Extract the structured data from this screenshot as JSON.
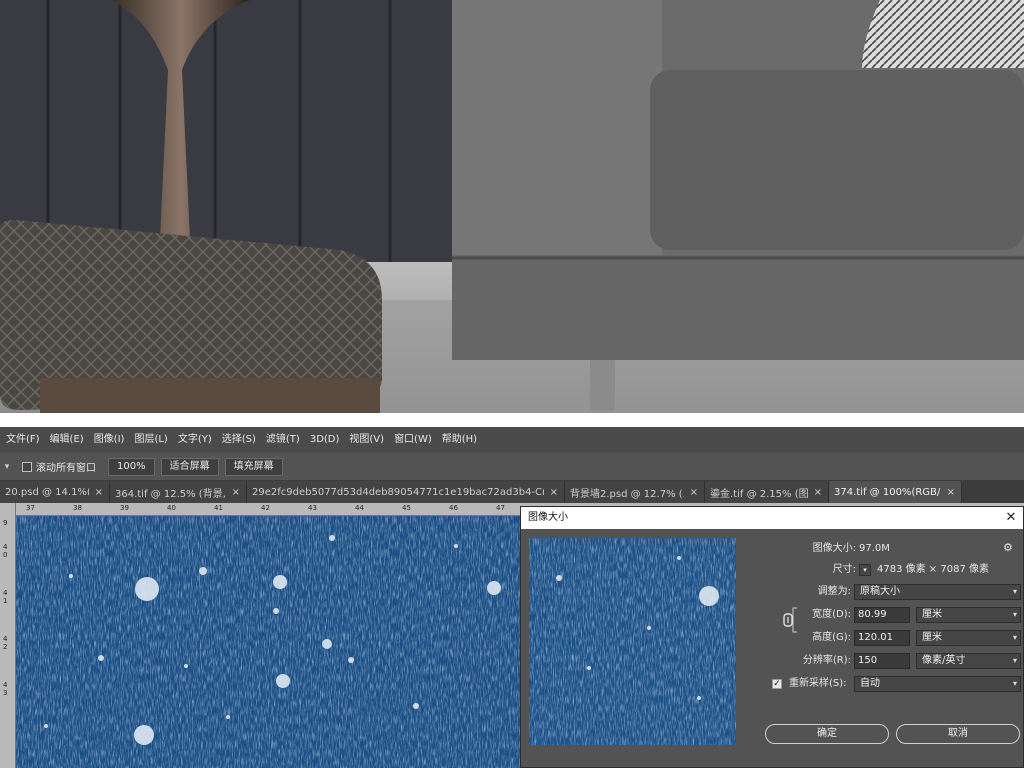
{
  "menu": [
    "文件(F)",
    "编辑(E)",
    "图像(I)",
    "图层(L)",
    "文字(Y)",
    "选择(S)",
    "滤镜(T)",
    "3D(D)",
    "视图(V)",
    "窗口(W)",
    "帮助(H)"
  ],
  "options": {
    "scroll_all_label": "滚动所有窗口",
    "zoom_btn": "100%",
    "fit_screen_btn": "适合屏幕",
    "fill_screen_btn": "填充屏幕"
  },
  "tabs": [
    {
      "label": "20.psd @ 14.1%(RG...",
      "active": false
    },
    {
      "label": "364.tif @ 12.5% (背景, R...",
      "active": false
    },
    {
      "label": "29e2fc9deb5077d53d4deb89054771c1e19bac72ad3b4-CrBj0S.png",
      "active": false
    },
    {
      "label": "背景墙2.psd @ 12.7% (...",
      "active": false
    },
    {
      "label": "鎏金.tif @ 2.15% (图层 1...",
      "active": false
    },
    {
      "label": "374.tif @ 100%(RGB/8#)",
      "active": true
    }
  ],
  "ruler": {
    "top": [
      "37",
      "38",
      "39",
      "40",
      "41",
      "42",
      "43",
      "44",
      "45",
      "46",
      "47"
    ],
    "left": [
      "9",
      "4 0",
      "4 1",
      "4 2",
      "4 3"
    ]
  },
  "dialog": {
    "title": "图像大小",
    "close_icon": "close-icon",
    "image_size_label": "图像大小:",
    "image_size_value": "97.0M",
    "dimensions_label": "尺寸:",
    "dimensions_value": "4783 像素 × 7087 像素",
    "fit_to_label": "调整为:",
    "fit_to_value": "原稿大小",
    "width_label": "宽度(D):",
    "width_value": "80.99",
    "width_unit": "厘米",
    "height_label": "高度(G):",
    "height_value": "120.01",
    "height_unit": "厘米",
    "resolution_label": "分辨率(R):",
    "resolution_value": "150",
    "resolution_unit": "像素/英寸",
    "resample_label": "重新采样(S):",
    "resample_value": "自动",
    "ok_label": "确定",
    "cancel_label": "取消"
  },
  "colors": {
    "canvas_blue": "#1b4f86",
    "panel_gray": "#535353",
    "menubar_gray": "#4b4b4b"
  }
}
